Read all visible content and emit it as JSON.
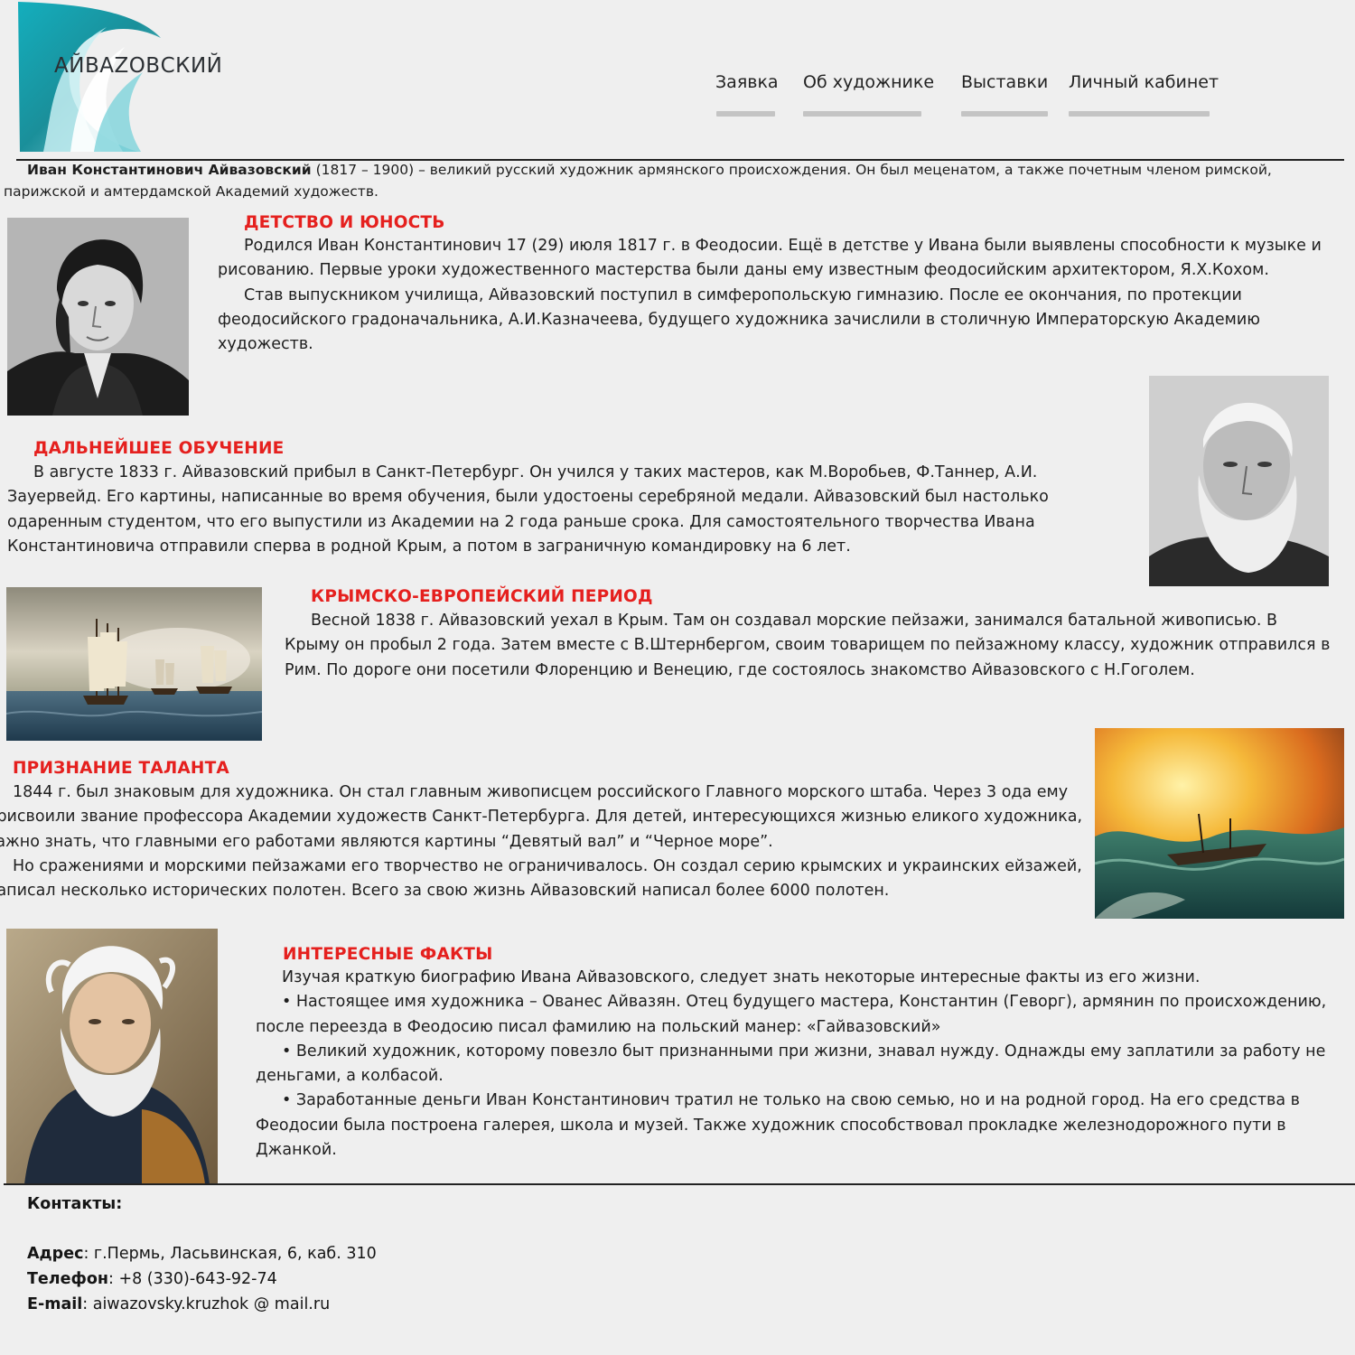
{
  "logo": {
    "text": "АЙВАZОВСКИЙ"
  },
  "nav": {
    "items": [
      {
        "label": "Заявка"
      },
      {
        "label": "Об художнике"
      },
      {
        "label": "Выставки"
      },
      {
        "label": "Личный кабинет"
      }
    ]
  },
  "intro": {
    "name": "Иван Константинович Айвазовский",
    "text": " (1817 – 1900) – великий русский художник армянского происхождения. Он был меценатом, а также почетным членом римской, парижской и амтердамской Академий художеств."
  },
  "sections": [
    {
      "title": "ДЕТСТВО И ЮНОСТЬ",
      "paragraphs": [
        "Родился Иван Константинович 17 (29) июля 1817 г. в Феодосии. Ещё в детстве у Ивана были выявлены способности к музыке и рисованию. Первые уроки художественного мастерства были даны ему известным феодосийским архитектором, Я.Х.Кохом.",
        "Став выпускником училища, Айвазовский поступил в симферопольскую гимназию. После ее окончания, по протекции феодосийского градоначальника, А.И.Казначеева, будущего художника зачислили в столичную Императорскую Академию художеств."
      ]
    },
    {
      "title": "ДАЛЬНЕЙШЕЕ ОБУЧЕНИЕ",
      "paragraphs": [
        "В августе 1833 г. Айвазовский прибыл в Санкт-Петербург. Он учился у таких мастеров, как М.Воробьев, Ф.Таннер, А.И. Зауервейд. Его картины, написанные во время обучения, были удостоены серебряной медали. Айвазовский был настолько одаренным студентом, что его выпустили из Академии на 2 года раньше срока. Для самостоятельного творчества Ивана Константиновича отправили сперва в родной Крым, а потом в заграничную командировку на 6 лет."
      ]
    },
    {
      "title": "КРЫМСКО-ЕВРОПЕЙСКИЙ ПЕРИОД",
      "paragraphs": [
        "Весной 1838 г. Айвазовский уехал в Крым. Там он создавал морские пейзажи, занимался батальной живописью. В Крыму он пробыл 2 года. Затем вместе с В.Штернбергом, своим товарищем по пейзажному классу, художник отправился в Рим. По дороге они посетили Флоренцию и Венецию, где состоялось знакомство Айвазовского с Н.Гоголем."
      ]
    },
    {
      "title": "ПРИЗНАНИЕ ТАЛАНТА",
      "paragraphs": [
        "1844 г. был знаковым для художника. Он стал главным живописцем российского Главного морского штаба. Через 3 ода ему присвоили звание профессора Академии художеств Санкт-Петербурга. Для детей, интересующихся жизнью еликого художника, важно знать, что главными его работами являются картины “Девятый вал” и “Черное море”.",
        "Но сражениями и морскими пейзажами его творчество не ограничивалось. Он создал серию крымских и украинских ейзажей, написал несколько исторических полотен. Всего за свою жизнь Айвазовский написал более 6000 полотен."
      ]
    },
    {
      "title": "ИНТЕРЕСНЫЕ ФАКТЫ",
      "paragraphs": [
        "Изучая краткую биографию Ивана Айвазовского, следует знать некоторые интересные факты из его жизни.",
        "• Настоящее имя художника – Ованес Айвазян. Отец будущего мастера, Константин (Геворг), армянин по происхождению, после переезда в Феодосию писал фамилию на польский манер: «Гайвазовский»",
        "• Великий художник, которому повезло быт признанными при жизни, знавал нужду. Однажды ему заплатили за работу не деньгами, а колбасой.",
        "• Заработанные деньги Иван Константинович тратил не только на свою семью, но и на родной город. На его средства в Феодосии была построена галерея, школа и музей. Также художник способствовал прокладке железнодорожного пути в Джанкой."
      ]
    }
  ],
  "contacts": {
    "title": "Контакты:",
    "address_label": "Адрес",
    "address": ": г.Пермь, Ласьвинская, 6, каб. 310",
    "phone_label": "Телефон",
    "phone": ": +8 (330)-643-92-74",
    "email_label": "E-mail",
    "email": ": aiwazovsky.kruzhok @ mail.ru"
  },
  "colors": {
    "accent": "#e5201e",
    "logo_teal": "#1aa3a8",
    "nav_underline": "#c4c4c4"
  }
}
